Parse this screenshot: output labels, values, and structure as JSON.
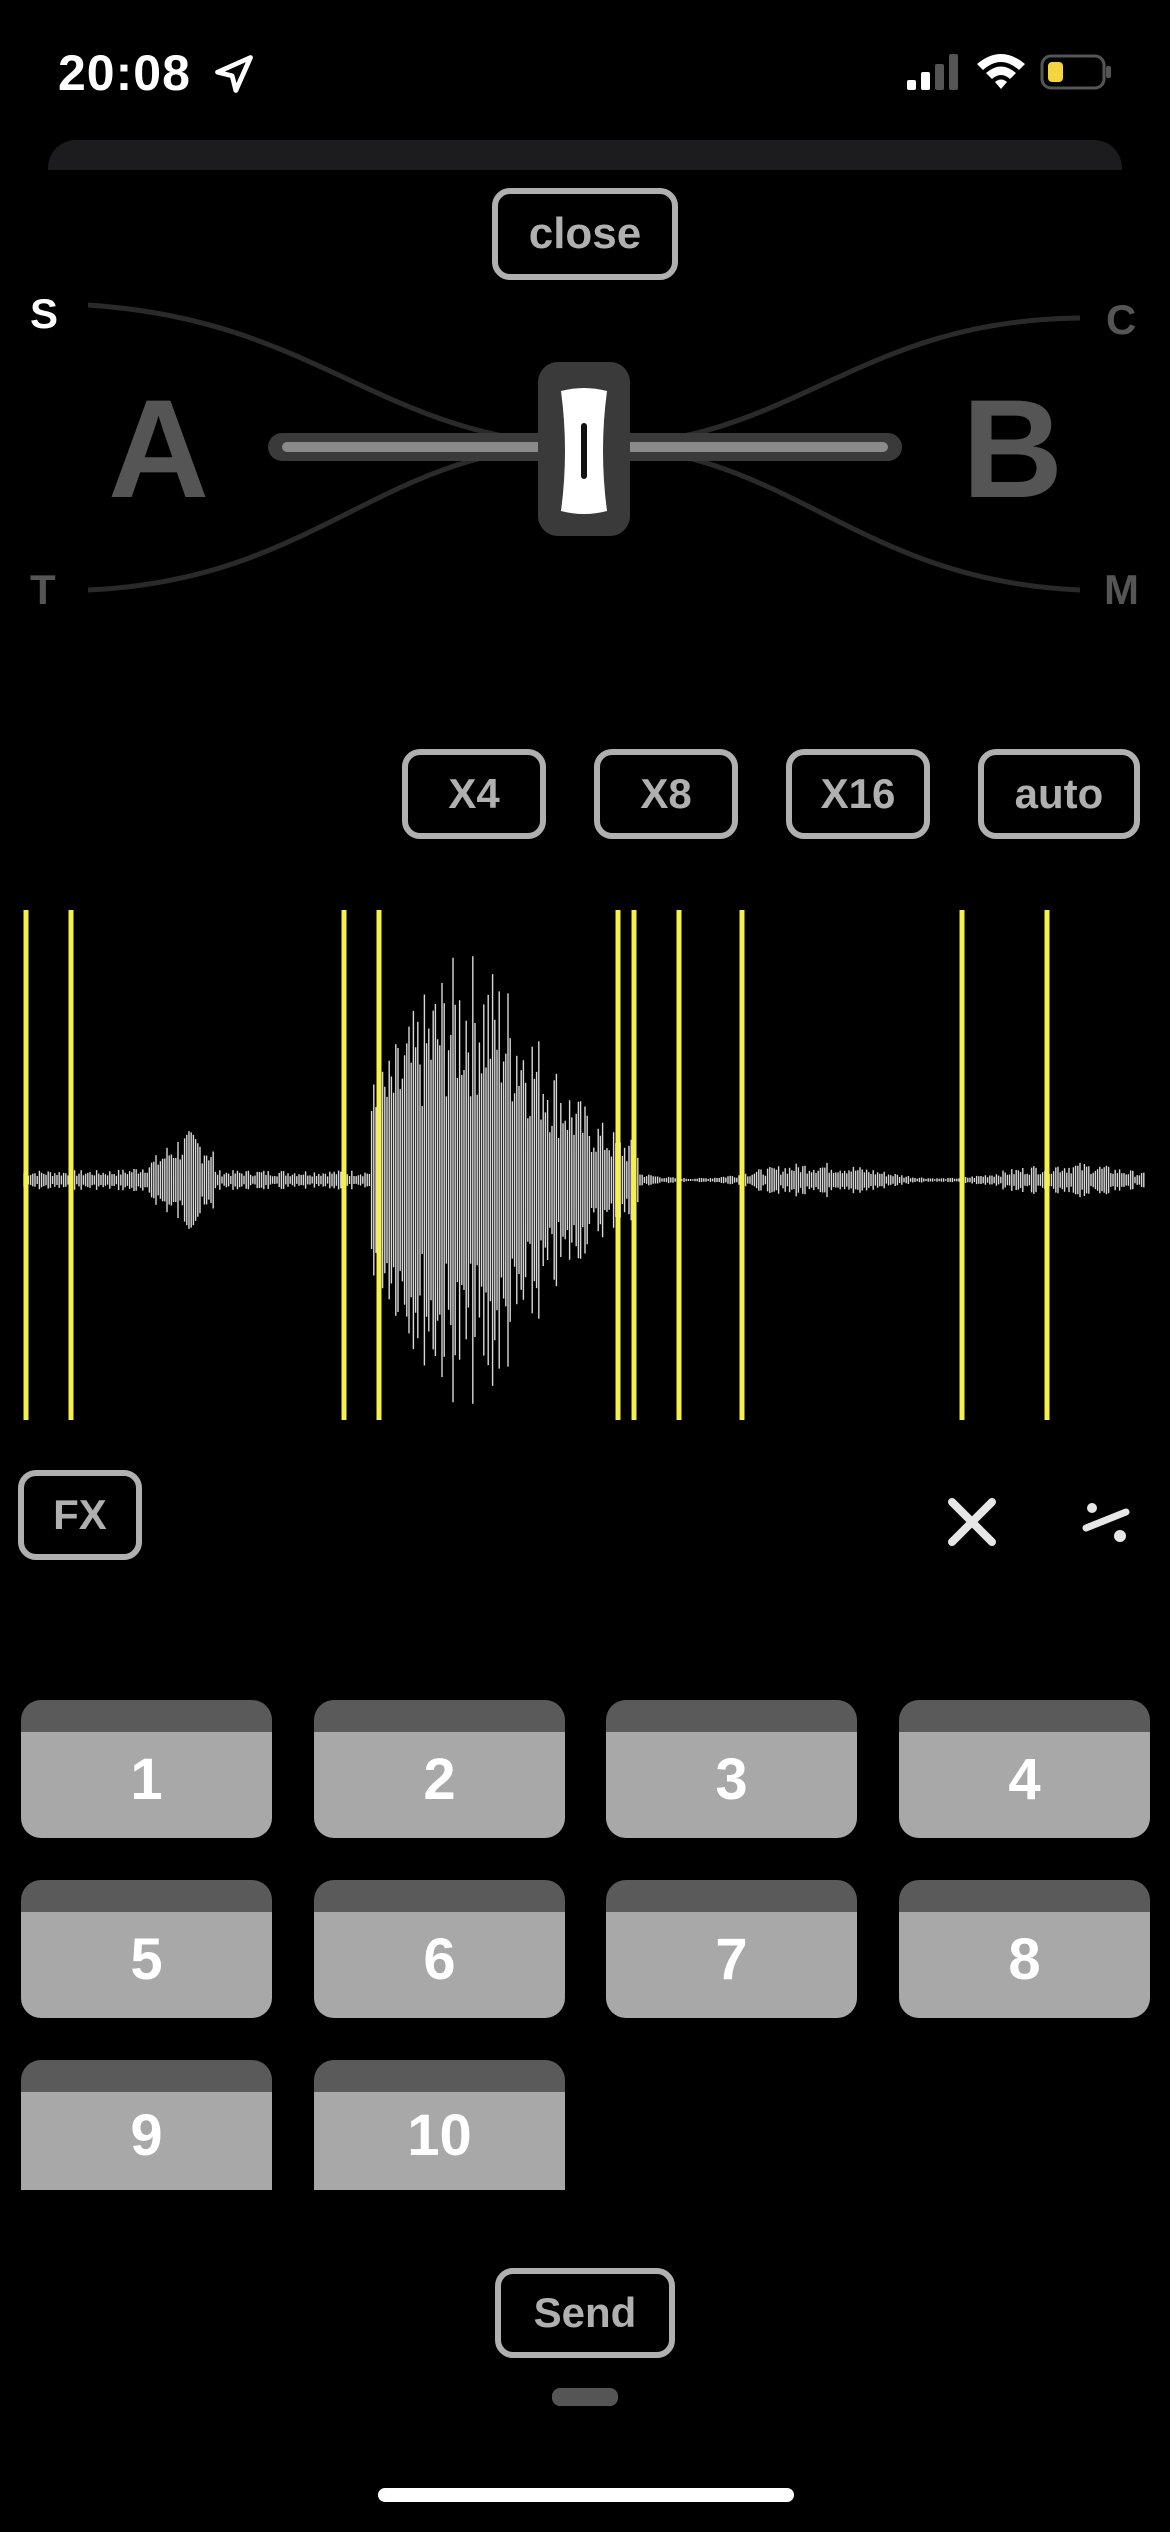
{
  "status_bar": {
    "time": "20:08",
    "battery_color": "#f5d442"
  },
  "close_label": "close",
  "crossfader": {
    "deck_a": "A",
    "deck_b": "B",
    "corners": {
      "top_left": "S",
      "bottom_left": "T",
      "top_right": "C",
      "bottom_right": "M"
    },
    "position": 0.5
  },
  "loop_buttons": {
    "x4": "X4",
    "x8": "X8",
    "x16": "X16",
    "auto": "auto"
  },
  "waveform": {
    "marker_color": "#f5f04a"
  },
  "fx_label": "FX",
  "pads": [
    {
      "label": "1"
    },
    {
      "label": "2"
    },
    {
      "label": "3"
    },
    {
      "label": "4"
    },
    {
      "label": "5"
    },
    {
      "label": "6"
    },
    {
      "label": "7"
    },
    {
      "label": "8"
    },
    {
      "label": "9"
    },
    {
      "label": "10"
    }
  ],
  "send_label": "Send"
}
